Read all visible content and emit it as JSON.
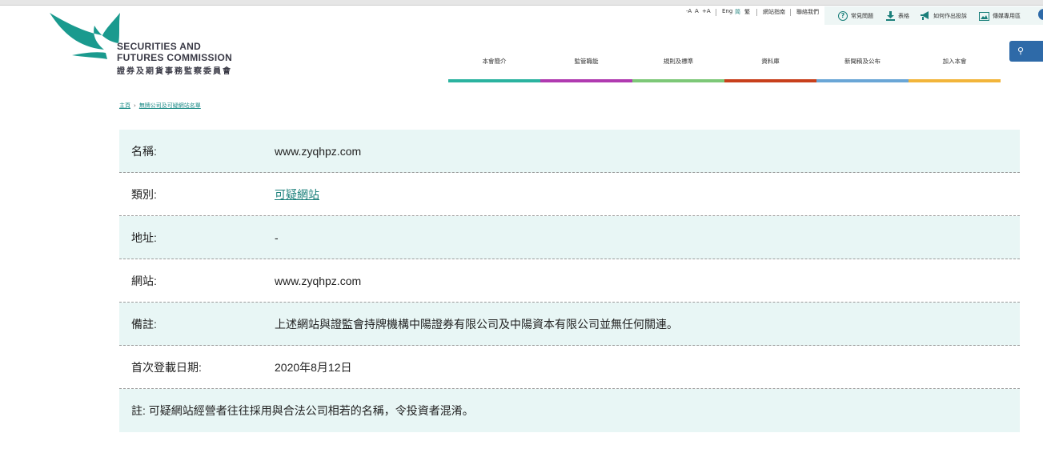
{
  "logo": {
    "line1": "SECURITIES AND",
    "line2": "FUTURES COMMISSION",
    "line3": "證券及期貨事務監察委員會",
    "colors": {
      "bird": "#1a9a8e",
      "text": "#3a3a46"
    }
  },
  "utility": {
    "font_small": "-A",
    "font_mid": "A",
    "font_large": "+A",
    "lang_en": "Eng",
    "lang_sc": "简",
    "lang_tc": "繁",
    "sitemap": "網站指南",
    "contact": "聯絡我們"
  },
  "quick_links": [
    {
      "label": "常見問題",
      "icon": "question-circle-icon"
    },
    {
      "label": "表格",
      "icon": "download-icon"
    },
    {
      "label": "如何作出投訴",
      "icon": "megaphone-icon"
    },
    {
      "label": "傳媒專用區",
      "icon": "image-icon"
    }
  ],
  "nav": [
    {
      "label": "本會簡介",
      "color": "#2bb3a0"
    },
    {
      "label": "監管職能",
      "color": "#b03ab0"
    },
    {
      "label": "規則及標準",
      "color": "#7dc878"
    },
    {
      "label": "資料庫",
      "color": "#c8401c"
    },
    {
      "label": "新聞稿及公布",
      "color": "#6aa6d6"
    },
    {
      "label": "加入本會",
      "color": "#f2b53a"
    }
  ],
  "breadcrumb": {
    "home": "主頁",
    "current": "無牌公司及可疑網站名單"
  },
  "details": {
    "name_label": "名稱:",
    "name_value": "www.zyqhpz.com",
    "category_label": "類別:",
    "category_value": "可疑網站",
    "address_label": "地址:",
    "address_value": "-",
    "website_label": "網站:",
    "website_value": "www.zyqhpz.com",
    "remarks_label": "備註:",
    "remarks_value": "上述網站與證監會持牌機構中陽證券有限公司及中陽資本有限公司並無任何關連。",
    "date_label": "首次登載日期:",
    "date_value": "2020年8月12日",
    "footnote": "註: 可疑網站經營者往往採用與合法公司相若的名稱，令投資者混淆。"
  },
  "colors": {
    "row_shade": "#e8f6f5",
    "link": "#1a7f7a",
    "search_button": "#2e6aa8"
  }
}
